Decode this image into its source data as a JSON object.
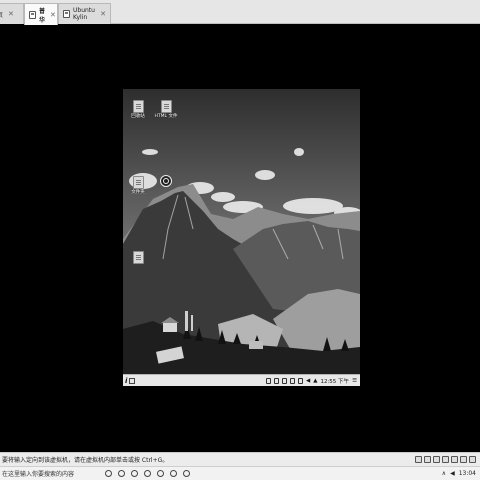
{
  "tabs": [
    {
      "label": "主页",
      "icon": "home-tab-icon"
    },
    {
      "label": "普华",
      "icon": "vm-tab-icon",
      "active": true
    },
    {
      "label": "Ubuntu Kylin",
      "icon": "vm-tab-icon"
    }
  ],
  "guest": {
    "desktop_icons": [
      {
        "label": "回收站",
        "icon": "trash-icon"
      },
      {
        "label": "HTML 文件",
        "icon": "html-file-icon"
      },
      {
        "label": "文件夹",
        "icon": "folder-icon"
      },
      {
        "label": "",
        "icon": "app-icon"
      },
      {
        "label": "",
        "icon": "file-icon"
      }
    ],
    "panel": {
      "start_label": "i",
      "clock": "12:55 下午"
    }
  },
  "statusbar": {
    "text": "要将输入定向到该虚拟机，请在虚拟机内部单击或按 Ctrl+G。"
  },
  "taskbar": {
    "search_placeholder": "在这里输入你要搜索的内容",
    "clock_time": "13:04"
  }
}
